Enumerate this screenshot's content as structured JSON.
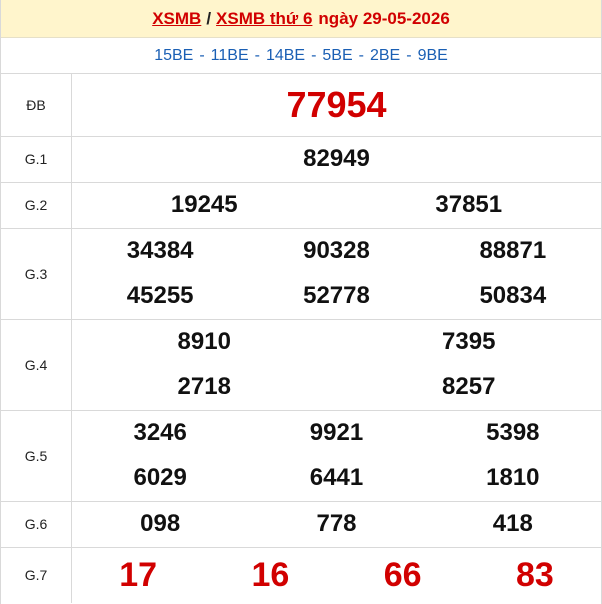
{
  "header": {
    "link1": "XSMB",
    "separator": "/",
    "link2": "XSMB thứ 6",
    "date_text": "ngày 29-05-2026"
  },
  "codes": [
    "15BE",
    "11BE",
    "14BE",
    "5BE",
    "2BE",
    "9BE"
  ],
  "prizes": {
    "db": {
      "label": "ĐB",
      "numbers": [
        "77954"
      ]
    },
    "g1": {
      "label": "G.1",
      "numbers": [
        "82949"
      ]
    },
    "g2": {
      "label": "G.2",
      "numbers": [
        "19245",
        "37851"
      ]
    },
    "g3": {
      "label": "G.3",
      "numbers": [
        "34384",
        "90328",
        "88871",
        "45255",
        "52778",
        "50834"
      ]
    },
    "g4": {
      "label": "G.4",
      "numbers": [
        "8910",
        "7395",
        "2718",
        "8257"
      ]
    },
    "g5": {
      "label": "G.5",
      "numbers": [
        "3246",
        "9921",
        "5398",
        "6029",
        "6441",
        "1810"
      ]
    },
    "g6": {
      "label": "G.6",
      "numbers": [
        "098",
        "778",
        "418"
      ]
    },
    "g7": {
      "label": "G.7",
      "numbers": [
        "17",
        "16",
        "66",
        "83"
      ]
    }
  },
  "colors": {
    "accent_red": "#d10000",
    "code_blue": "#1a5fb4",
    "header_bg": "#fff5cc"
  }
}
